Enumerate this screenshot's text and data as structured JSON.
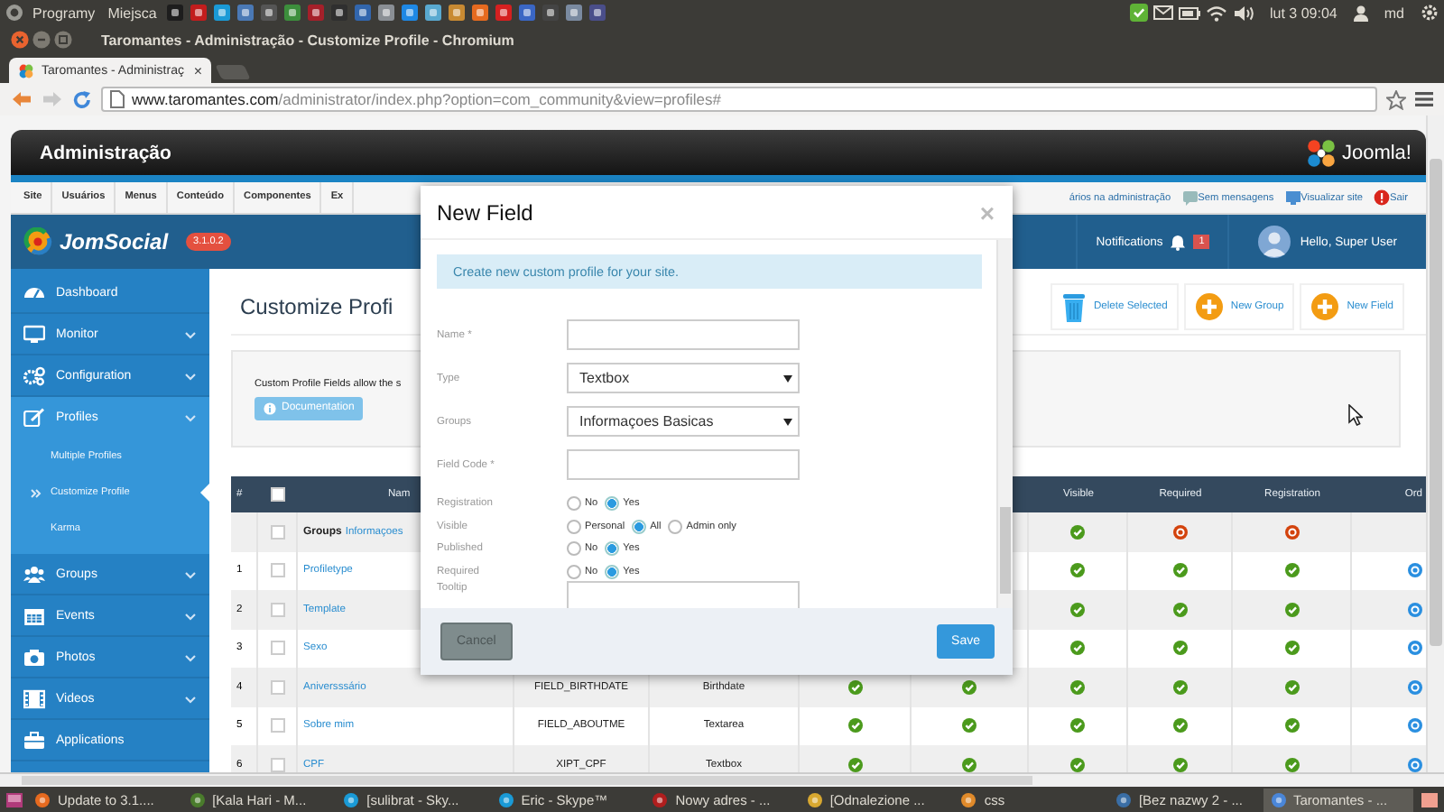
{
  "top_panel": {
    "menus": [
      "Programy",
      "Miejsca"
    ],
    "clock": "lut 3 09:04",
    "user": "md"
  },
  "window": {
    "title": "Taromantes - Administração - Customize Profile - Chromium"
  },
  "tabs": [
    {
      "label": "Taromantes - Administraç",
      "close": "×",
      "selected": true
    }
  ],
  "address_bar": {
    "host": "www.taromantes.com",
    "path": "/administrator/index.php?option=com_community&view=profiles#"
  },
  "admin_header": {
    "title": "Administração",
    "logo": "Joomla!"
  },
  "admin_menu": {
    "items": [
      "Site",
      "Usuários",
      "Menus",
      "Conteúdo",
      "Componentes",
      "Ex"
    ],
    "right": [
      "ários na administração",
      "Sem mensagens",
      "Visualizar site",
      "Sair"
    ]
  },
  "app_bar": {
    "logo": "JomSocial",
    "version": "3.1.0.2",
    "notifications": "Notifications",
    "notification_count": "1",
    "greeting": "Hello, Super User"
  },
  "sidebar": {
    "items": [
      {
        "label": "Dashboard",
        "expandable": false
      },
      {
        "label": "Monitor",
        "expandable": true
      },
      {
        "label": "Configuration",
        "expandable": true
      },
      {
        "label": "Profiles",
        "expandable": true,
        "expanded": true,
        "children": [
          {
            "label": "Multiple Profiles",
            "selected": false
          },
          {
            "label": "Customize Profile",
            "selected": true
          },
          {
            "label": "Karma",
            "selected": false
          }
        ]
      },
      {
        "label": "Groups",
        "expandable": true
      },
      {
        "label": "Events",
        "expandable": true
      },
      {
        "label": "Photos",
        "expandable": true
      },
      {
        "label": "Videos",
        "expandable": true
      },
      {
        "label": "Applications",
        "expandable": false
      }
    ]
  },
  "page": {
    "title": "Customize Profi",
    "toolbar": [
      "Delete Selected",
      "New Group",
      "New Field"
    ],
    "info_text": "Custom Profile Fields allow the s",
    "documentation": "Documentation"
  },
  "table": {
    "columns": {
      "number": "#",
      "name": "Nam",
      "visible": "Visible",
      "required": "Required",
      "registration": "Registration",
      "ordering": "Ord"
    },
    "header_checked": false,
    "rows": [
      {
        "kind": "group",
        "checked": false,
        "label": "Groups",
        "group_name": "Informaçoes",
        "visible": true,
        "required": false,
        "registration": false
      },
      {
        "kind": "field",
        "number": "1",
        "checked": false,
        "name": "Profiletype",
        "visible": true,
        "required": true,
        "registration": true
      },
      {
        "kind": "field",
        "number": "2",
        "checked": false,
        "name": "Template",
        "visible": true,
        "required": true,
        "registration": true
      },
      {
        "kind": "field",
        "number": "3",
        "checked": false,
        "name": "Sexo",
        "visible": true,
        "required": true,
        "registration": true
      },
      {
        "kind": "field",
        "number": "4",
        "checked": false,
        "name": "Aniversssário",
        "column_4": "FIELD_BIRTHDATE",
        "column_5": "Birthdate",
        "column_6": true,
        "column_7": true,
        "visible": true,
        "required": true,
        "registration": true
      },
      {
        "kind": "field",
        "number": "5",
        "checked": false,
        "name": "Sobre mim",
        "column_4": "FIELD_ABOUTME",
        "column_5": "Textarea",
        "column_6": true,
        "column_7": true,
        "visible": true,
        "required": true,
        "registration": true
      },
      {
        "kind": "field",
        "number": "6",
        "checked": false,
        "name": "CPF",
        "column_4": "XIPT_CPF",
        "column_5": "Textbox",
        "column_6": true,
        "column_7": true,
        "visible": true,
        "required": true,
        "registration": true
      }
    ]
  },
  "dialog": {
    "title": "New Field",
    "close": "×",
    "notice": "Create new custom profile for your site.",
    "fields": [
      {
        "kind": "text",
        "label": "Name *"
      },
      {
        "kind": "select",
        "label": "Type",
        "value": "Textbox"
      },
      {
        "kind": "select",
        "label": "Groups",
        "value": "Informaçoes Basicas"
      },
      {
        "kind": "text",
        "label": "Field Code *"
      },
      {
        "kind": "radio",
        "label": "Registration",
        "options": [
          {
            "label": "No",
            "selected": false
          },
          {
            "label": "Yes",
            "selected": true
          }
        ]
      },
      {
        "kind": "radio",
        "label": "Visible",
        "options": [
          {
            "label": "Personal",
            "selected": false
          },
          {
            "label": "All",
            "selected": true
          },
          {
            "label": "Admin only",
            "selected": false
          }
        ]
      },
      {
        "kind": "radio",
        "label": "Published",
        "options": [
          {
            "label": "No",
            "selected": false
          },
          {
            "label": "Yes",
            "selected": true
          }
        ]
      },
      {
        "kind": "radio",
        "label": "Required",
        "options": [
          {
            "label": "No",
            "selected": false
          },
          {
            "label": "Yes",
            "selected": true
          }
        ]
      },
      {
        "kind": "textarea",
        "label": "Tooltip"
      }
    ],
    "buttons": [
      {
        "kind": "secondary",
        "label": "Cancel"
      },
      {
        "kind": "primary",
        "label": "Save"
      }
    ]
  },
  "taskbar": {
    "items": [
      {
        "label": "Update to 3.1....",
        "selected": false
      },
      {
        "label": "[Kala Hari - M...",
        "selected": false
      },
      {
        "label": "[sulibrat - Sky...",
        "selected": false
      },
      {
        "label": "Eric - Skype™",
        "selected": false
      },
      {
        "label": "Nowy adres - ...",
        "selected": false
      },
      {
        "label": "[Odnalezione ...",
        "selected": false
      },
      {
        "label": "css",
        "selected": false
      },
      {
        "label": "[Bez nazwy 2 - ...",
        "selected": false
      },
      {
        "label": "Taromantes - ...",
        "selected": true
      }
    ]
  }
}
